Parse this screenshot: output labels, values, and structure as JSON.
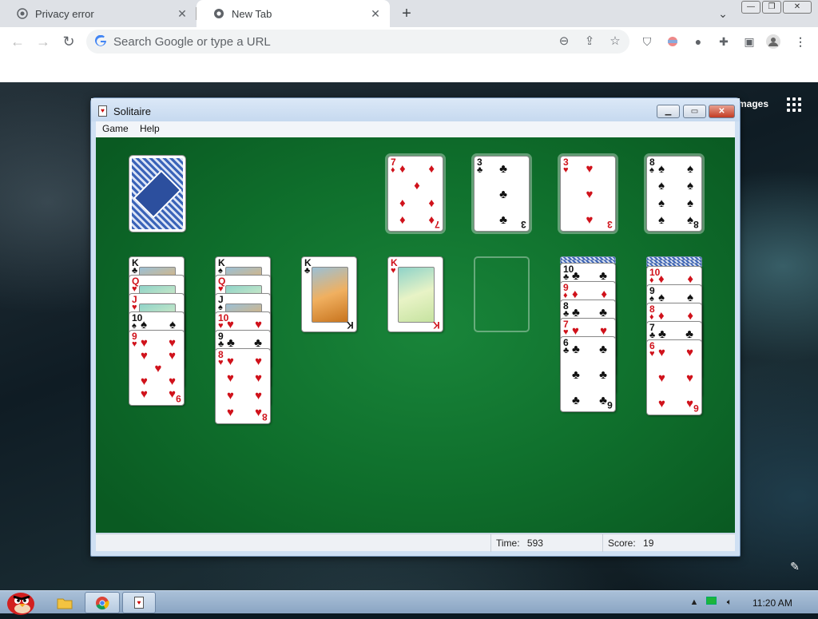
{
  "browser": {
    "tabs": [
      {
        "title": "Privacy error",
        "active": false
      },
      {
        "title": "New Tab",
        "active": true
      }
    ],
    "omnibox": {
      "placeholder": "Search Google or type a URL",
      "value": ""
    }
  },
  "ntp": {
    "images_link": "mages"
  },
  "solitaire": {
    "title": "Solitaire",
    "menu": [
      "Game",
      "Help"
    ],
    "status": {
      "time_label": "Time:",
      "time_value": "593",
      "score_label": "Score:",
      "score_value": "19"
    },
    "stock": {
      "face_down": true
    },
    "foundations": [
      {
        "rank": "7",
        "suit": "diamonds"
      },
      {
        "rank": "3",
        "suit": "clubs"
      },
      {
        "rank": "3",
        "suit": "hearts"
      },
      {
        "rank": "8",
        "suit": "spades"
      }
    ],
    "tableau": [
      {
        "hidden": 0,
        "cards": [
          "K clubs",
          "Q hearts",
          "J hearts",
          "10 spades",
          "9 hearts"
        ]
      },
      {
        "hidden": 0,
        "cards": [
          "K spades",
          "Q hearts",
          "J spades",
          "10 hearts",
          "9 clubs",
          "8 hearts"
        ]
      },
      {
        "hidden": 0,
        "cards": [
          "K clubs"
        ]
      },
      {
        "hidden": 0,
        "cards": [
          "K hearts"
        ]
      },
      {
        "hidden": 0,
        "cards": []
      },
      {
        "hidden": 2,
        "cards": [
          "10 clubs",
          "9 diamonds",
          "8 clubs",
          "7 hearts",
          "6 clubs"
        ]
      },
      {
        "hidden": 3,
        "cards": [
          "10 diamonds",
          "9 spades",
          "8 diamonds",
          "7 clubs",
          "6 hearts"
        ]
      }
    ]
  },
  "taskbar": {
    "clock": "11:20 AM"
  },
  "colors": {
    "felt": "#0f6f2c",
    "red_suit": "#d0121b",
    "chrome_tabstrip": "#dee1e6"
  }
}
